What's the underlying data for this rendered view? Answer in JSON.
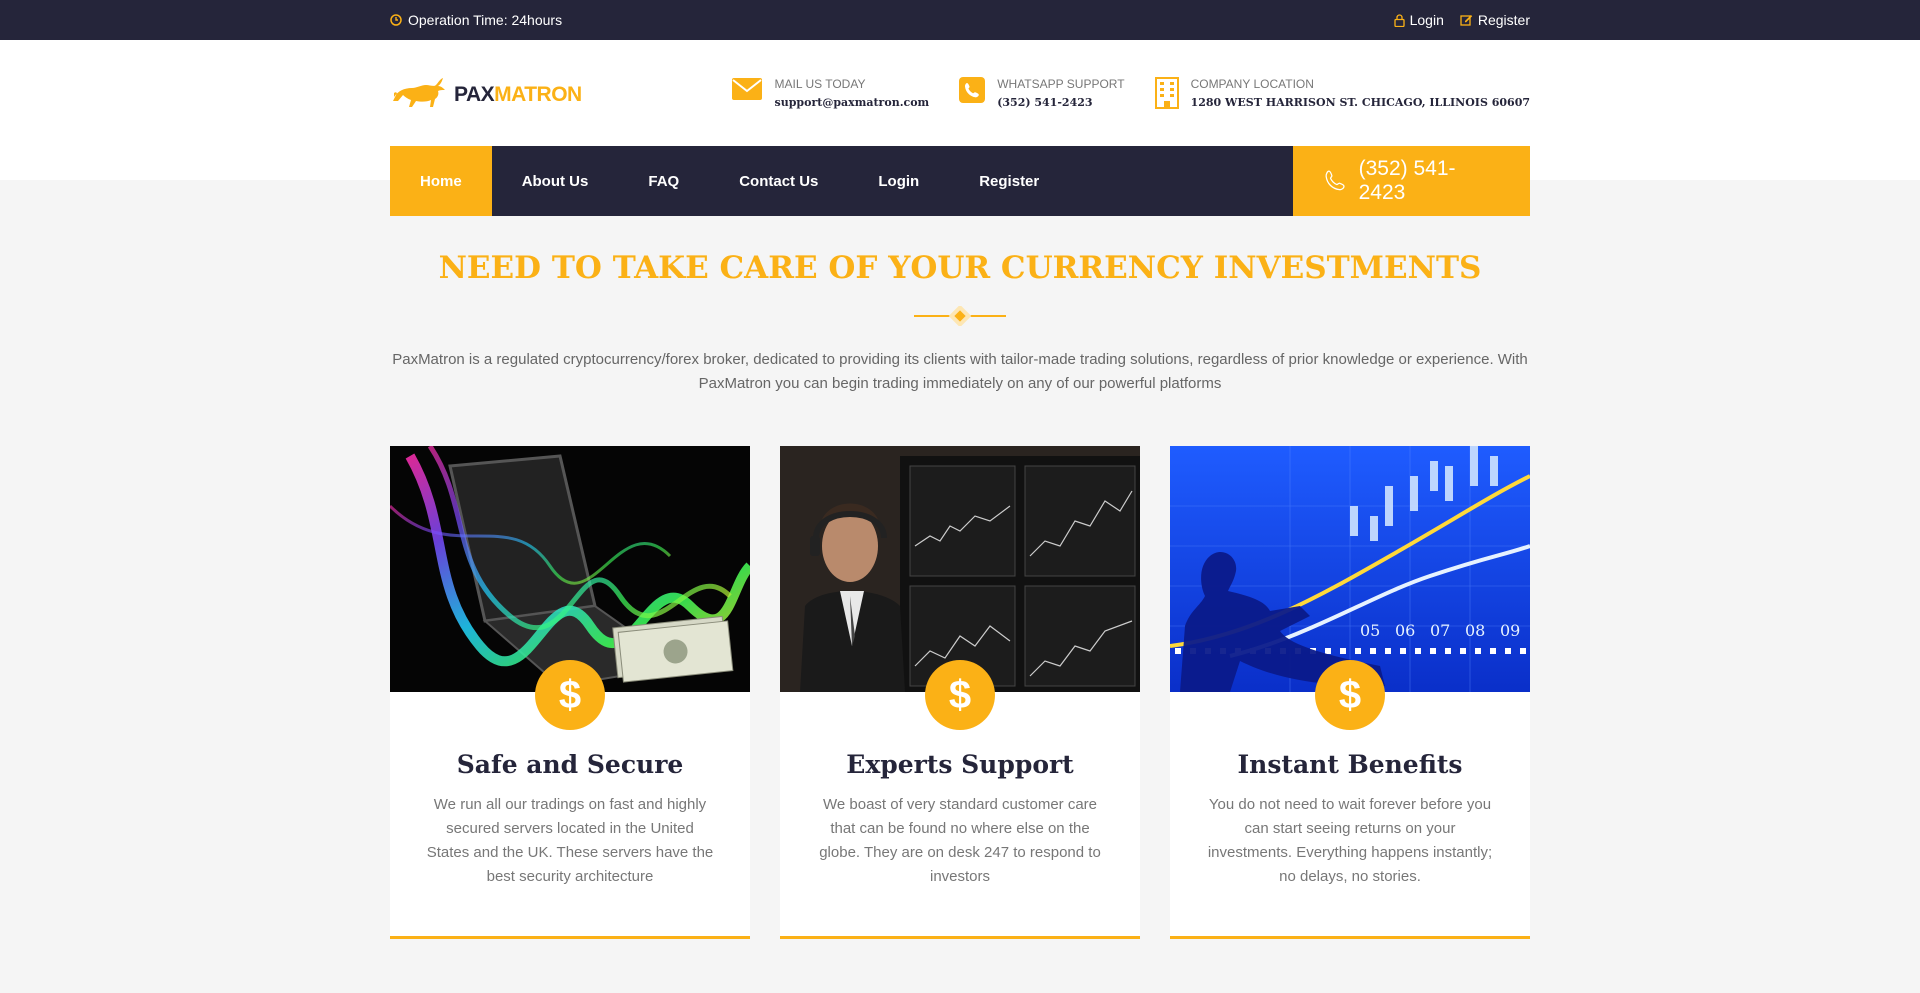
{
  "topbar": {
    "operation": "Operation Time: 24hours",
    "login": "Login",
    "register": "Register"
  },
  "logo": {
    "pax": "PAX",
    "matron": "MATRON"
  },
  "contact": [
    {
      "label": "MAIL US TODAY",
      "value": "support@paxmatron.com",
      "icon": "envelope-icon"
    },
    {
      "label": "WHATSAPP SUPPORT",
      "value": "(352) 541-2423",
      "icon": "phone-icon"
    },
    {
      "label": "COMPANY LOCATION",
      "value": "1280 WEST HARRISON ST. CHICAGO, ILLINOIS 60607",
      "icon": "building-icon"
    }
  ],
  "nav": {
    "items": [
      "Home",
      "About Us",
      "FAQ",
      "Contact Us",
      "Login",
      "Register"
    ],
    "phone": "(352) 541-2423"
  },
  "hero": {
    "title": "NEED TO TAKE CARE OF YOUR CURRENCY INVESTMENTS",
    "text": "PaxMatron is a regulated cryptocurrency/forex broker, dedicated to providing its clients with tailor-made trading solutions, regardless of prior knowledge or experience. With PaxMatron you can begin trading immediately on any of our powerful platforms"
  },
  "cards": [
    {
      "title": "Safe and Secure",
      "text": "We run all our tradings on fast and highly secured servers located in the United States and the UK. These servers have the best security architecture",
      "badge": "$"
    },
    {
      "title": "Experts Support",
      "text": "We boast of very standard customer care that can be found no where else on the globe. They are on desk 247 to respond to investors",
      "badge": "$"
    },
    {
      "title": "Instant Benefits",
      "text": "You do not need to wait forever before you can start seeing returns on your investments. Everything happens instantly; no delays, no stories.",
      "badge": "$"
    }
  ],
  "chart_labels": [
    "05",
    "06",
    "07",
    "08",
    "09"
  ],
  "colors": {
    "accent": "#fbb116",
    "dark": "#25253a"
  }
}
